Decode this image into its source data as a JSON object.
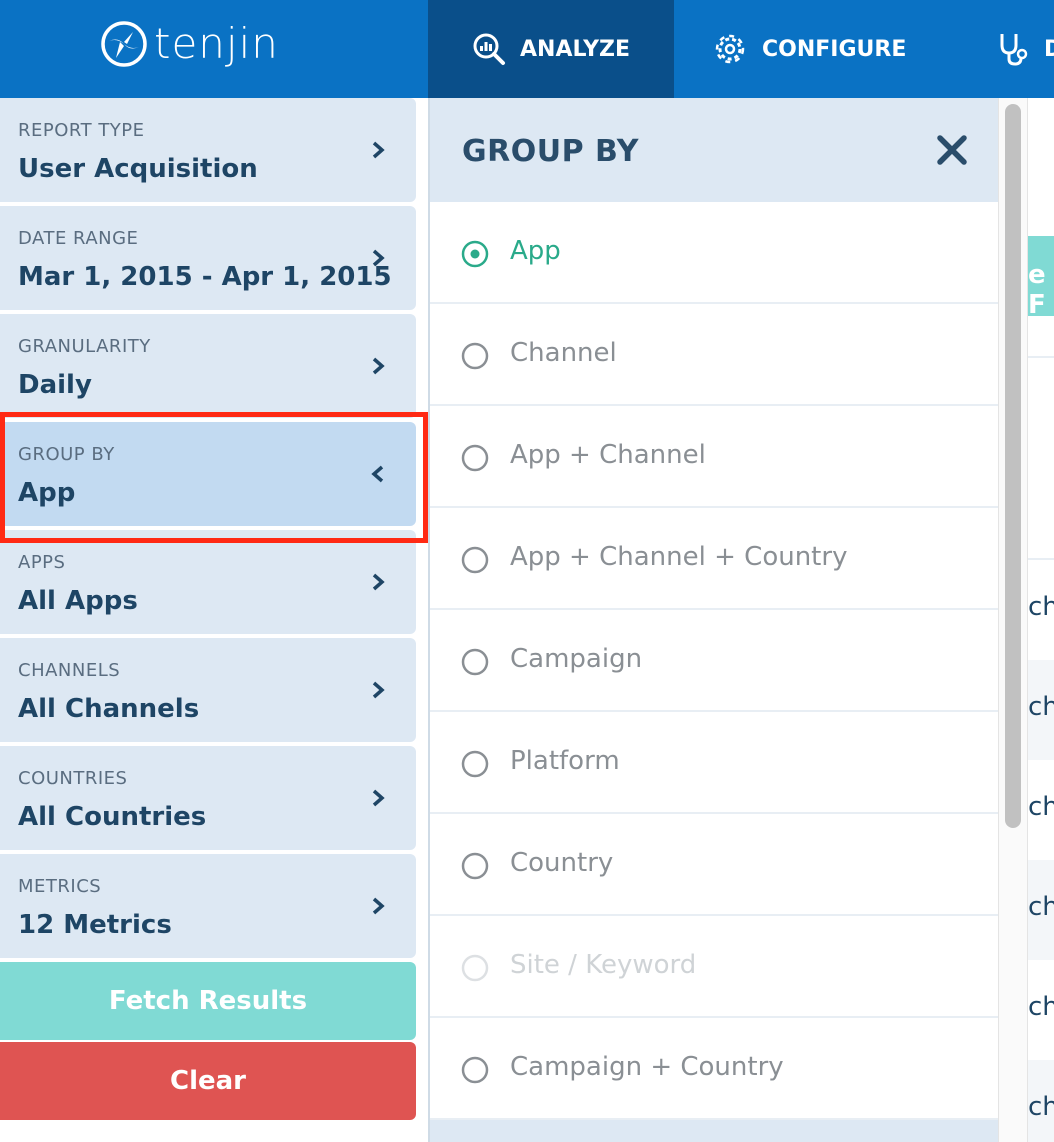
{
  "brand": {
    "name": "tenjin"
  },
  "nav": {
    "analyze": "ANALYZE",
    "configure": "CONFIGURE",
    "partial": "D"
  },
  "sidebar": {
    "items": [
      {
        "label": "REPORT TYPE",
        "value": "User Acquisition"
      },
      {
        "label": "DATE RANGE",
        "value": "Mar 1, 2015 - Apr 1, 2015"
      },
      {
        "label": "GRANULARITY",
        "value": "Daily"
      },
      {
        "label": "GROUP BY",
        "value": "App"
      },
      {
        "label": "APPS",
        "value": "All Apps"
      },
      {
        "label": "CHANNELS",
        "value": "All Channels"
      },
      {
        "label": "COUNTRIES",
        "value": "All Countries"
      },
      {
        "label": "METRICS",
        "value": "12 Metrics"
      }
    ],
    "fetch_label": "Fetch Results",
    "clear_label": "Clear"
  },
  "panel": {
    "title": "GROUP BY",
    "options": [
      {
        "label": "App",
        "state": "selected"
      },
      {
        "label": "Channel",
        "state": "normal"
      },
      {
        "label": "App + Channel",
        "state": "normal"
      },
      {
        "label": "App + Channel + Country",
        "state": "normal"
      },
      {
        "label": "Campaign",
        "state": "normal"
      },
      {
        "label": "Platform",
        "state": "normal"
      },
      {
        "label": "Country",
        "state": "normal"
      },
      {
        "label": "Site / Keyword",
        "state": "disabled"
      },
      {
        "label": "Campaign + Country",
        "state": "normal"
      }
    ]
  },
  "background": {
    "button_text": "e F",
    "row_text": "ch"
  },
  "colors": {
    "header": "#0a72c4",
    "header_active": "#0a4f8a",
    "sidebar_bg": "#dde8f3",
    "sidebar_active": "#c2daf1",
    "highlight": "#ff2a14",
    "fetch": "#80dad4",
    "clear": "#df5452",
    "selected": "#2aaa8a"
  }
}
